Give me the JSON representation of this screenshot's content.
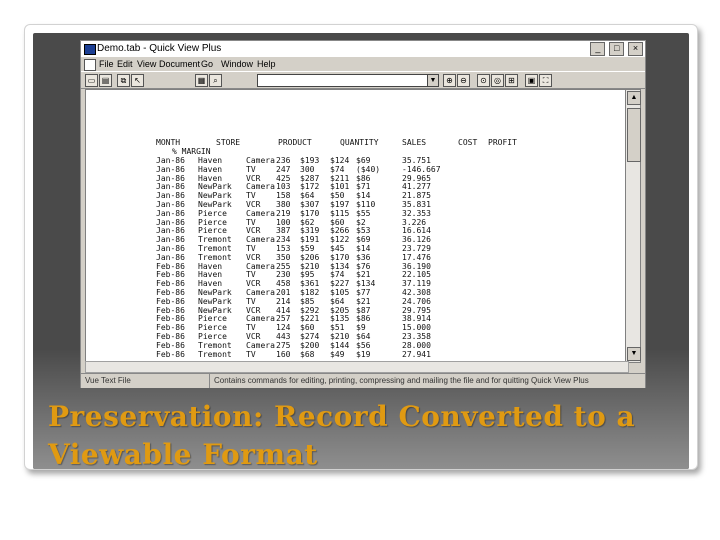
{
  "slide": {
    "caption": "Preservation: Record Converted to a Viewable Format"
  },
  "window": {
    "title": "Demo.tab - Quick View Plus",
    "controls": [
      "_",
      "□",
      "×"
    ],
    "menu": [
      "File",
      "Edit",
      "View",
      "Document",
      "Go",
      "Window",
      "Help"
    ],
    "toolbar_icons": [
      "open-icon",
      "print-icon",
      "copy-icon",
      "select-icon",
      "find-icon",
      "find-next-icon",
      "zoom-in-icon",
      "zoom-out-icon",
      "zoom-fit-icon",
      "view-icon",
      "grid-icon",
      "fullscreen-icon"
    ]
  },
  "document": {
    "headers": [
      "MONTH",
      "STORE",
      "PRODUCT",
      "QUANTITY",
      "SALES",
      "COST",
      "PROFIT"
    ],
    "subheader": "% MARGIN",
    "rows": [
      [
        "Jan-86",
        "Haven",
        "Camera",
        "236",
        "$193",
        "$124",
        "$69",
        "35.751"
      ],
      [
        "Jan-86",
        "Haven",
        "TV",
        "247",
        "300",
        "$74",
        "($40)",
        "-146.667"
      ],
      [
        "Jan-86",
        "Haven",
        "VCR",
        "425",
        "$287",
        "$211",
        "$86",
        "29.965"
      ],
      [
        "Jan-86",
        "NewPark",
        "Camera",
        "103",
        "$172",
        "$101",
        "$71",
        "41.277"
      ],
      [
        "Jan-86",
        "NewPark",
        "TV",
        "158",
        "$64",
        "$50",
        "$14",
        "21.875"
      ],
      [
        "Jan-86",
        "NewPark",
        "VCR",
        "380",
        "$307",
        "$197",
        "$110",
        "35.831"
      ],
      [
        "Jan-86",
        "Pierce",
        "Camera",
        "219",
        "$170",
        "$115",
        "$55",
        "32.353"
      ],
      [
        "Jan-86",
        "Pierce",
        "TV",
        "100",
        "$62",
        "$60",
        "$2",
        "3.226"
      ],
      [
        "Jan-86",
        "Pierce",
        "VCR",
        "387",
        "$319",
        "$266",
        "$53",
        "16.614"
      ],
      [
        "Jan-86",
        "Tremont",
        "Camera",
        "234",
        "$191",
        "$122",
        "$69",
        "36.126"
      ],
      [
        "Jan-86",
        "Tremont",
        "TV",
        "153",
        "$59",
        "$45",
        "$14",
        "23.729"
      ],
      [
        "Jan-86",
        "Tremont",
        "VCR",
        "350",
        "$206",
        "$170",
        "$36",
        "17.476"
      ],
      [
        "Feb-86",
        "Haven",
        "Camera",
        "255",
        "$210",
        "$134",
        "$76",
        "36.190"
      ],
      [
        "Feb-86",
        "Haven",
        "TV",
        "230",
        "$95",
        "$74",
        "$21",
        "22.105"
      ],
      [
        "Feb-86",
        "Haven",
        "VCR",
        "458",
        "$361",
        "$227",
        "$134",
        "37.119"
      ],
      [
        "Feb-86",
        "NewPark",
        "Camera",
        "201",
        "$182",
        "$105",
        "$77",
        "42.308"
      ],
      [
        "Feb-86",
        "NewPark",
        "TV",
        "214",
        "$85",
        "$64",
        "$21",
        "24.706"
      ],
      [
        "Feb-86",
        "NewPark",
        "VCR",
        "414",
        "$292",
        "$205",
        "$87",
        "29.795"
      ],
      [
        "Feb-86",
        "Pierce",
        "Camera",
        "257",
        "$221",
        "$135",
        "$86",
        "38.914"
      ],
      [
        "Feb-86",
        "Pierce",
        "TV",
        "124",
        "$60",
        "$51",
        "$9",
        "15.000"
      ],
      [
        "Feb-86",
        "Pierce",
        "VCR",
        "443",
        "$274",
        "$210",
        "$64",
        "23.358"
      ],
      [
        "Feb-86",
        "Tremont",
        "Camera",
        "275",
        "$200",
        "$144",
        "$56",
        "28.000"
      ],
      [
        "Feb-86",
        "Tremont",
        "TV",
        "160",
        "$68",
        "$49",
        "$19",
        "27.941"
      ]
    ]
  },
  "status": {
    "left": "Vue Text File",
    "right": "Contains commands for editing, printing, compressing and mailing the file and for quitting Quick View Plus"
  }
}
